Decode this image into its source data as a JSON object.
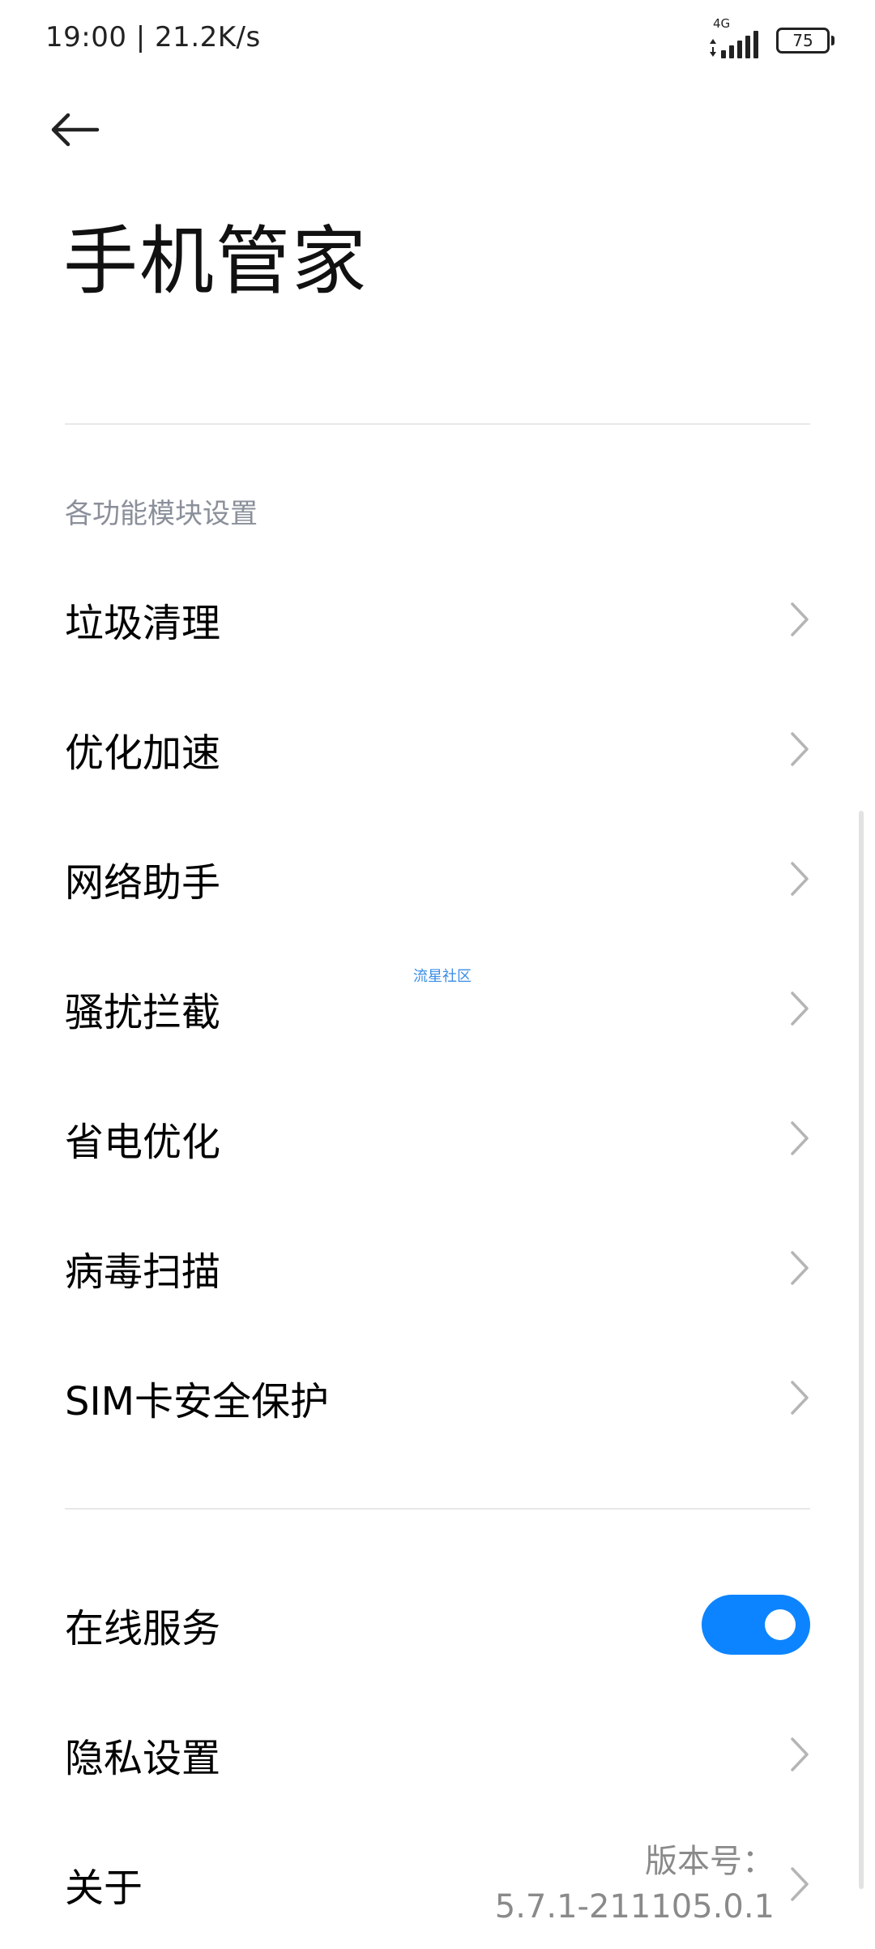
{
  "status_bar": {
    "time": "19:00 | 21.2K/s",
    "network_type": "4G",
    "battery": "75"
  },
  "header": {
    "back_icon": "arrow-left-icon",
    "title": "手机管家"
  },
  "section": {
    "header": "各功能模块设置",
    "items": [
      {
        "label": "垃圾清理"
      },
      {
        "label": "优化加速"
      },
      {
        "label": "网络助手"
      },
      {
        "label": "骚扰拦截"
      },
      {
        "label": "省电优化"
      },
      {
        "label": "病毒扫描"
      },
      {
        "label": "SIM卡安全保护"
      }
    ]
  },
  "settings": {
    "online_service": {
      "label": "在线服务",
      "enabled": true
    },
    "privacy": {
      "label": "隐私设置"
    },
    "about": {
      "label": "关于",
      "version_label": "版本号：",
      "version_value": "5.7.1-211105.0.1"
    }
  },
  "watermark": "流星社区",
  "colors": {
    "accent": "#0d84ff",
    "section_header": "#8a8f9a",
    "divider": "#e8e8e8",
    "chevron": "#b5b5b5"
  }
}
